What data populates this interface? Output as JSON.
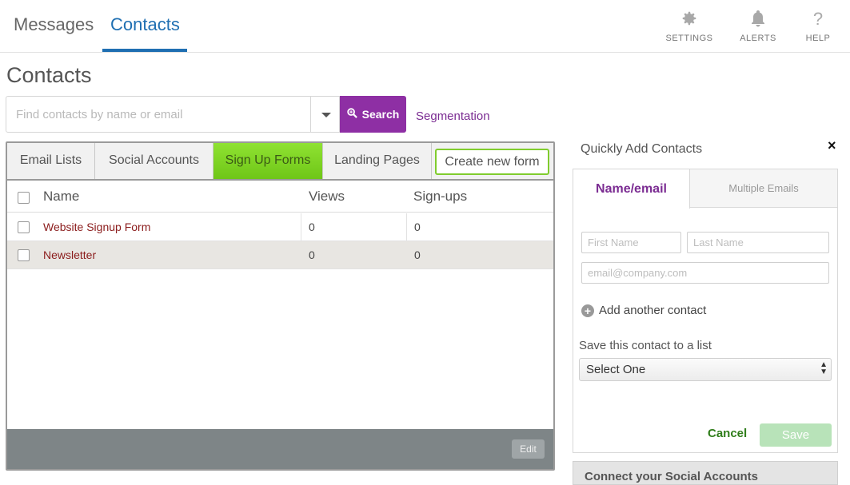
{
  "topnav": {
    "tabs": [
      {
        "label": "Messages",
        "active": false
      },
      {
        "label": "Contacts",
        "active": true
      }
    ],
    "utilities": [
      {
        "label": "SETTINGS",
        "icon": "gear-icon"
      },
      {
        "label": "ALERTS",
        "icon": "bell-icon"
      },
      {
        "label": "HELP",
        "icon": "question-icon"
      }
    ],
    "accent_color": "#1f6fb2"
  },
  "page": {
    "title": "Contacts"
  },
  "search": {
    "placeholder": "Find contacts by name or email",
    "button_label": "Search",
    "button_color": "#8e2fa4",
    "segmentation_link": "Segmentation"
  },
  "panel": {
    "tabs": [
      {
        "label": "Email Lists",
        "active": false
      },
      {
        "label": "Social Accounts",
        "active": false
      },
      {
        "label": "Sign Up Forms",
        "active": true
      },
      {
        "label": "Landing Pages",
        "active": false
      }
    ],
    "create_button": "Create new form",
    "columns": [
      "Name",
      "Views",
      "Sign-ups"
    ],
    "rows": [
      {
        "name": "Website Signup Form",
        "views": "0",
        "signups": "0"
      },
      {
        "name": "Newsletter",
        "views": "0",
        "signups": "0"
      }
    ],
    "edit_button": "Edit"
  },
  "quick_add": {
    "title": "Quickly Add Contacts",
    "close_glyph": "×",
    "tabs": [
      {
        "label": "Name/email",
        "active": true
      },
      {
        "label": "Multiple Emails",
        "active": false
      }
    ],
    "first_name_placeholder": "First Name",
    "last_name_placeholder": "Last Name",
    "email_placeholder": "email@company.com",
    "add_another": "Add another contact",
    "save_to_list_label": "Save this contact to a list",
    "list_select_value": "Select One",
    "cancel": "Cancel",
    "save": "Save"
  },
  "social_section": {
    "title": "Connect your Social Accounts"
  }
}
